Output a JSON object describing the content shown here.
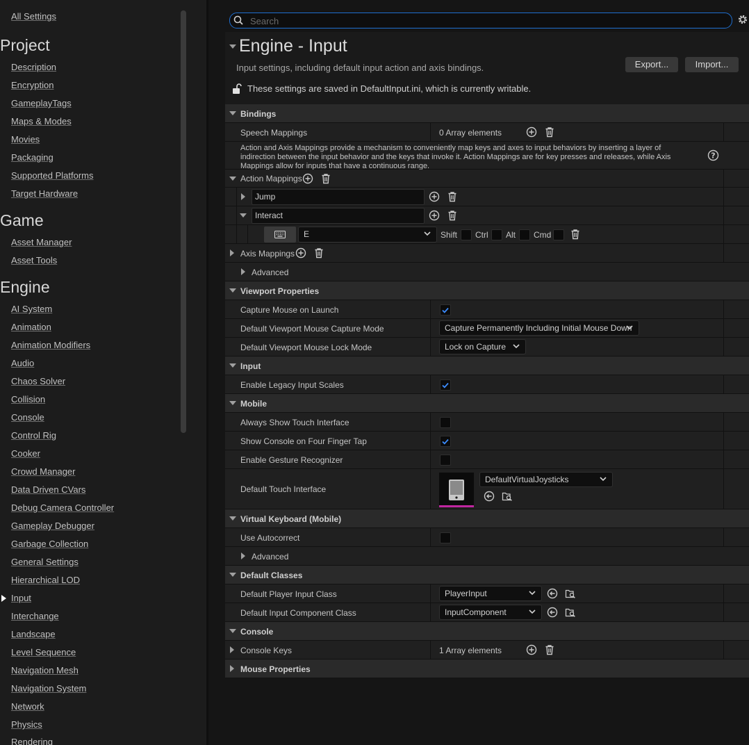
{
  "sidebar": {
    "all_settings": "All Settings",
    "categories": [
      {
        "title": "Project",
        "items": [
          "Description",
          "Encryption",
          "GameplayTags",
          "Maps & Modes",
          "Movies",
          "Packaging",
          "Supported Platforms",
          "Target Hardware"
        ]
      },
      {
        "title": "Game",
        "items": [
          "Asset Manager",
          "Asset Tools"
        ]
      },
      {
        "title": "Engine",
        "items": [
          "AI System",
          "Animation",
          "Animation Modifiers",
          "Audio",
          "Chaos Solver",
          "Collision",
          "Console",
          "Control Rig",
          "Cooker",
          "Crowd Manager",
          "Data Driven CVars",
          "Debug Camera Controller",
          "Gameplay Debugger",
          "Garbage Collection",
          "General Settings",
          "Hierarchical LOD",
          "Input",
          "Interchange",
          "Landscape",
          "Level Sequence",
          "Navigation Mesh",
          "Navigation System",
          "Network",
          "Physics",
          "Rendering"
        ]
      }
    ],
    "active_item": "Input"
  },
  "search": {
    "placeholder": "Search",
    "value": ""
  },
  "header": {
    "title": "Engine - Input",
    "description": "Input settings, including default input action and axis bindings.",
    "export_label": "Export...",
    "import_label": "Import...",
    "save_note": "These settings are saved in DefaultInput.ini, which is currently writable."
  },
  "bindings": {
    "category": "Bindings",
    "speech_mappings": {
      "label": "Speech Mappings",
      "value": "0 Array elements"
    },
    "help_text": "Action and Axis Mappings provide a mechanism to conveniently map keys and axes to input behaviors by inserting a layer of indirection between the input behavior and the keys that invoke it. Action Mappings are for key presses and releases, while Axis Mappings allow for inputs that have a continuous range.",
    "action_mappings": {
      "label": "Action Mappings",
      "items": [
        {
          "name": "Jump",
          "expanded": false
        },
        {
          "name": "Interact",
          "expanded": true,
          "key": "E",
          "modifiers": {
            "shift": "Shift",
            "ctrl": "Ctrl",
            "alt": "Alt",
            "cmd": "Cmd"
          }
        }
      ]
    },
    "axis_mappings": {
      "label": "Axis Mappings"
    },
    "advanced": "Advanced"
  },
  "viewport": {
    "category": "Viewport Properties",
    "capture_mouse": {
      "label": "Capture Mouse on Launch",
      "checked": true
    },
    "capture_mode": {
      "label": "Default Viewport Mouse Capture Mode",
      "value": "Capture Permanently Including Initial Mouse Down"
    },
    "lock_mode": {
      "label": "Default Viewport Mouse Lock Mode",
      "value": "Lock on Capture"
    }
  },
  "input": {
    "category": "Input",
    "legacy_scales": {
      "label": "Enable Legacy Input Scales",
      "checked": true
    }
  },
  "mobile": {
    "category": "Mobile",
    "always_touch": {
      "label": "Always Show Touch Interface",
      "checked": false
    },
    "console_four_finger": {
      "label": "Show Console on Four Finger Tap",
      "checked": true
    },
    "gesture": {
      "label": "Enable Gesture Recognizer",
      "checked": false
    },
    "touch_interface": {
      "label": "Default Touch Interface",
      "value": "DefaultVirtualJoysticks"
    }
  },
  "virtual_keyboard": {
    "category": "Virtual Keyboard (Mobile)",
    "autocorrect": {
      "label": "Use Autocorrect",
      "checked": false
    },
    "advanced": "Advanced"
  },
  "default_classes": {
    "category": "Default Classes",
    "player_input": {
      "label": "Default Player Input Class",
      "value": "PlayerInput"
    },
    "input_component": {
      "label": "Default Input Component Class",
      "value": "InputComponent"
    }
  },
  "console": {
    "category": "Console",
    "console_keys": {
      "label": "Console Keys",
      "value": "1 Array elements"
    }
  },
  "mouse": {
    "category": "Mouse Properties"
  },
  "colors": {
    "accent": "#1f6fd0",
    "check": "#3b8cff",
    "asset_underline": "#c026a0"
  }
}
